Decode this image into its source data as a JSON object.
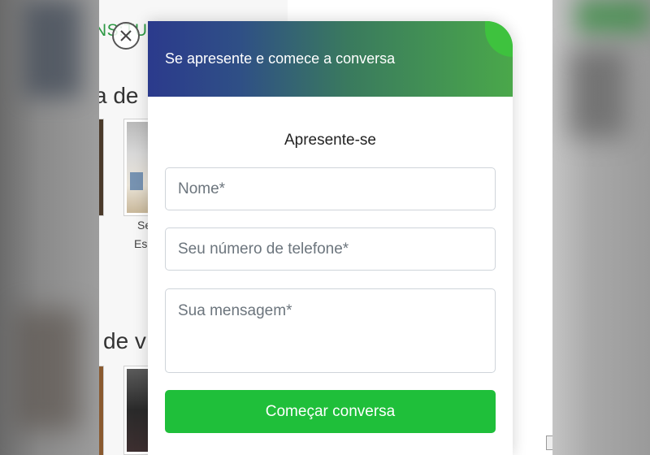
{
  "background_page": {
    "brand_text": "NS:TU",
    "section_heading_1": "a de",
    "section_heading_2": "de v",
    "caption_line_1": "Se",
    "caption_line_2": "Es"
  },
  "modal": {
    "header_title": "Se apresente e comece a conversa",
    "subtitle": "Apresente-se",
    "name_placeholder": "Nome*",
    "phone_placeholder": "Seu número de telefone*",
    "message_placeholder": "Sua mensagem*",
    "submit_label": "Começar conversa"
  },
  "icons": {
    "close": "close-icon"
  },
  "colors": {
    "header_gradient_start": "#2b3a8c",
    "header_gradient_end": "#4aa84a",
    "submit_green": "#1fbf3a",
    "brand_green": "#2e9a45"
  }
}
